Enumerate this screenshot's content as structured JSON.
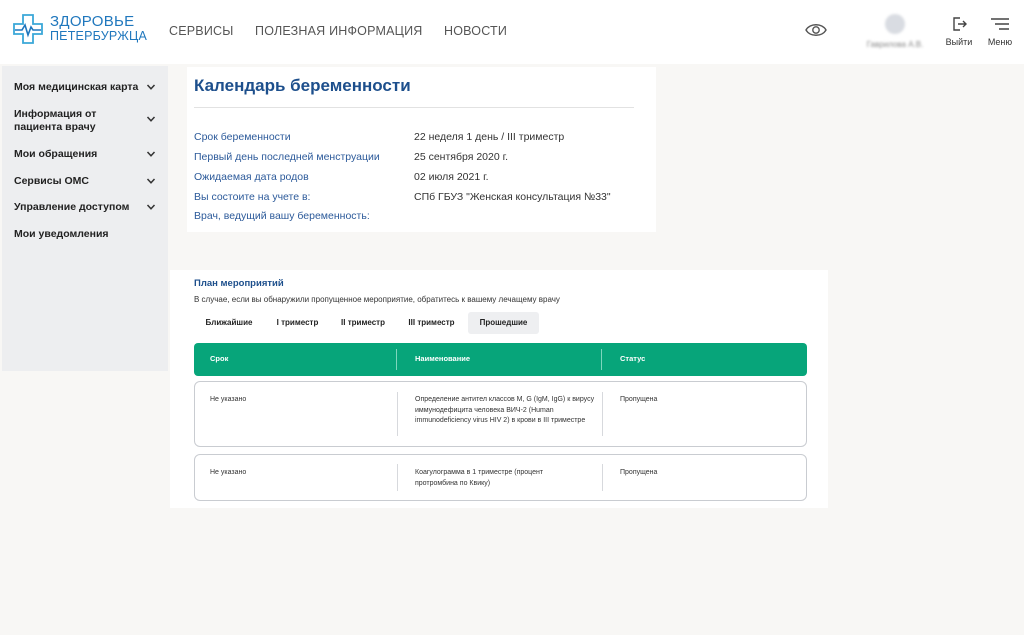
{
  "header": {
    "logo_line1": "ЗДОРОВЬЕ",
    "logo_line2": "ПЕТЕРБУРЖЦА",
    "nav": [
      "СЕРВИСЫ",
      "ПОЛЕЗНАЯ ИНФОРМАЦИЯ",
      "НОВОСТИ"
    ],
    "user_name": "Гаврилова А.В.",
    "logout_label": "Выйти",
    "menu_label": "Меню"
  },
  "sidebar": {
    "items": [
      {
        "label": "Моя медицинская карта",
        "has_chevron": true
      },
      {
        "label": "Информация от пациента врачу",
        "has_chevron": true
      },
      {
        "label": "Мои обращения",
        "has_chevron": true
      },
      {
        "label": "Сервисы ОМС",
        "has_chevron": true
      },
      {
        "label": "Управление доступом",
        "has_chevron": true
      },
      {
        "label": "Мои уведомления",
        "has_chevron": false
      }
    ]
  },
  "pregnancy": {
    "title": "Календарь беременности",
    "fields": [
      {
        "label": "Срок беременности",
        "value": "22 неделя 1 день / III триместр"
      },
      {
        "label": "Первый день последней менструации",
        "value": "25 сентября 2020 г."
      },
      {
        "label": "Ожидаемая дата родов",
        "value": "02 июля 2021 г."
      },
      {
        "label": "Вы состоите на учете в:",
        "value": "СПб ГБУЗ \"Женская консультация №33\""
      },
      {
        "label": "Врач, ведущий вашу беременность:",
        "value": ""
      }
    ]
  },
  "plan": {
    "title": "План мероприятий",
    "note": "В случае, если вы обнаружили пропущенное мероприятие, обратитесь к вашему лечащему врачу",
    "tabs": [
      "Ближайшие",
      "I триместр",
      "II триместр",
      "III триместр",
      "Прошедшие"
    ],
    "active_tab": "Прошедшие",
    "columns": [
      "Срок",
      "Наименование",
      "Статус"
    ],
    "rows": [
      {
        "term": "Не указано",
        "name": "Определение антител классов M, G (IgM, IgG) к вирусу иммунодефицита человека ВИЧ-2 (Human immunodeficiency virus HIV 2) в крови в III триместре",
        "status": "Пропущена"
      },
      {
        "term": "Не указано",
        "name": "Коагулограмма в 1 триместре (процент протромбина по Квику)",
        "status": "Пропущена"
      }
    ]
  },
  "colors": {
    "brand_blue": "#1f77bd",
    "title_blue": "#1d4f8c",
    "table_header_green": "#07a57a"
  }
}
